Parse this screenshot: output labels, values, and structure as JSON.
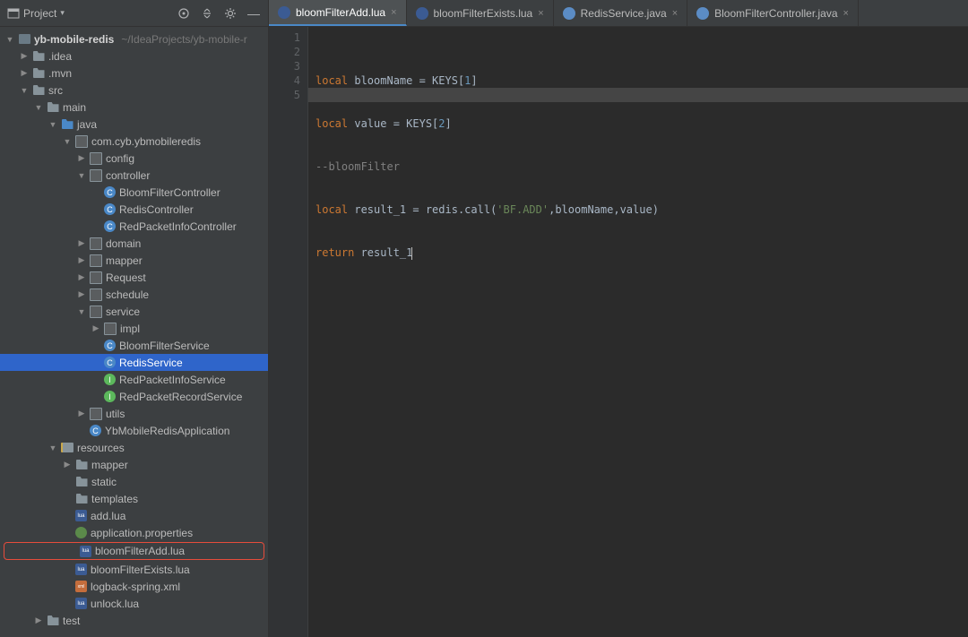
{
  "header": {
    "project_label": "Project",
    "dropdown_icon": "chevron-down-icon"
  },
  "tabs": [
    {
      "label": "bloomFilterAdd.lua",
      "icon": "lua",
      "active": true
    },
    {
      "label": "bloomFilterExists.lua",
      "icon": "lua",
      "active": false
    },
    {
      "label": "RedisService.java",
      "icon": "java",
      "active": false
    },
    {
      "label": "BloomFilterController.java",
      "icon": "java",
      "active": false
    }
  ],
  "tree": {
    "root": {
      "name": "yb-mobile-redis",
      "path_hint": "~/IdeaProjects/yb-mobile-r"
    },
    "items": [
      {
        "indent": 1,
        "arrow": "collapsed",
        "icon": "folder",
        "label": ".idea"
      },
      {
        "indent": 1,
        "arrow": "collapsed",
        "icon": "folder",
        "label": ".mvn"
      },
      {
        "indent": 1,
        "arrow": "expanded",
        "icon": "folder",
        "label": "src"
      },
      {
        "indent": 2,
        "arrow": "expanded",
        "icon": "folder",
        "label": "main"
      },
      {
        "indent": 3,
        "arrow": "expanded",
        "icon": "folder-open",
        "label": "java"
      },
      {
        "indent": 4,
        "arrow": "expanded",
        "icon": "pkg",
        "label": "com.cyb.ybmobileredis"
      },
      {
        "indent": 5,
        "arrow": "collapsed",
        "icon": "pkg",
        "label": "config"
      },
      {
        "indent": 5,
        "arrow": "expanded",
        "icon": "pkg",
        "label": "controller"
      },
      {
        "indent": 6,
        "arrow": "none",
        "icon": "class",
        "label": "BloomFilterController"
      },
      {
        "indent": 6,
        "arrow": "none",
        "icon": "class",
        "label": "RedisController"
      },
      {
        "indent": 6,
        "arrow": "none",
        "icon": "class",
        "label": "RedPacketInfoController"
      },
      {
        "indent": 5,
        "arrow": "collapsed",
        "icon": "pkg",
        "label": "domain"
      },
      {
        "indent": 5,
        "arrow": "collapsed",
        "icon": "pkg",
        "label": "mapper"
      },
      {
        "indent": 5,
        "arrow": "collapsed",
        "icon": "pkg",
        "label": "Request"
      },
      {
        "indent": 5,
        "arrow": "collapsed",
        "icon": "pkg",
        "label": "schedule"
      },
      {
        "indent": 5,
        "arrow": "expanded",
        "icon": "pkg",
        "label": "service"
      },
      {
        "indent": 6,
        "arrow": "collapsed",
        "icon": "pkg",
        "label": "impl"
      },
      {
        "indent": 6,
        "arrow": "none",
        "icon": "class",
        "label": "BloomFilterService"
      },
      {
        "indent": 6,
        "arrow": "none",
        "icon": "class",
        "label": "RedisService",
        "selected": true
      },
      {
        "indent": 6,
        "arrow": "none",
        "icon": "iface",
        "label": "RedPacketInfoService"
      },
      {
        "indent": 6,
        "arrow": "none",
        "icon": "iface",
        "label": "RedPacketRecordService"
      },
      {
        "indent": 5,
        "arrow": "collapsed",
        "icon": "pkg",
        "label": "utils"
      },
      {
        "indent": 5,
        "arrow": "none",
        "icon": "class",
        "label": "YbMobileRedisApplication"
      },
      {
        "indent": 3,
        "arrow": "expanded",
        "icon": "resources",
        "label": "resources"
      },
      {
        "indent": 4,
        "arrow": "collapsed",
        "icon": "folder",
        "label": "mapper"
      },
      {
        "indent": 4,
        "arrow": "none",
        "icon": "folder",
        "label": "static"
      },
      {
        "indent": 4,
        "arrow": "none",
        "icon": "folder",
        "label": "templates"
      },
      {
        "indent": 4,
        "arrow": "none",
        "icon": "lua",
        "label": "add.lua"
      },
      {
        "indent": 4,
        "arrow": "none",
        "icon": "prop",
        "label": "application.properties"
      },
      {
        "indent": 4,
        "arrow": "none",
        "icon": "lua",
        "label": "bloomFilterAdd.lua",
        "highlighted": true
      },
      {
        "indent": 4,
        "arrow": "none",
        "icon": "lua",
        "label": "bloomFilterExists.lua"
      },
      {
        "indent": 4,
        "arrow": "none",
        "icon": "xml",
        "label": "logback-spring.xml"
      },
      {
        "indent": 4,
        "arrow": "none",
        "icon": "lua",
        "label": "unlock.lua"
      },
      {
        "indent": 2,
        "arrow": "collapsed",
        "icon": "folder",
        "label": "test"
      }
    ]
  },
  "editor": {
    "lines": [
      "1",
      "2",
      "3",
      "4",
      "5"
    ],
    "code": {
      "l1": {
        "kw1": "local",
        "id1": " bloomName = KEYS[",
        "num1": "1",
        "id2": "]"
      },
      "l2": {
        "kw1": "local",
        "id1": " value = KEYS[",
        "num1": "2",
        "id2": "]"
      },
      "l3": {
        "c": "--bloomFilter"
      },
      "l4": {
        "kw1": "local",
        "id1": " result_1 = redis.call(",
        "str": "'BF.ADD'",
        "id2": ",bloomName,value)"
      },
      "l5": {
        "kw1": "return",
        "id1": " result_1"
      }
    }
  }
}
